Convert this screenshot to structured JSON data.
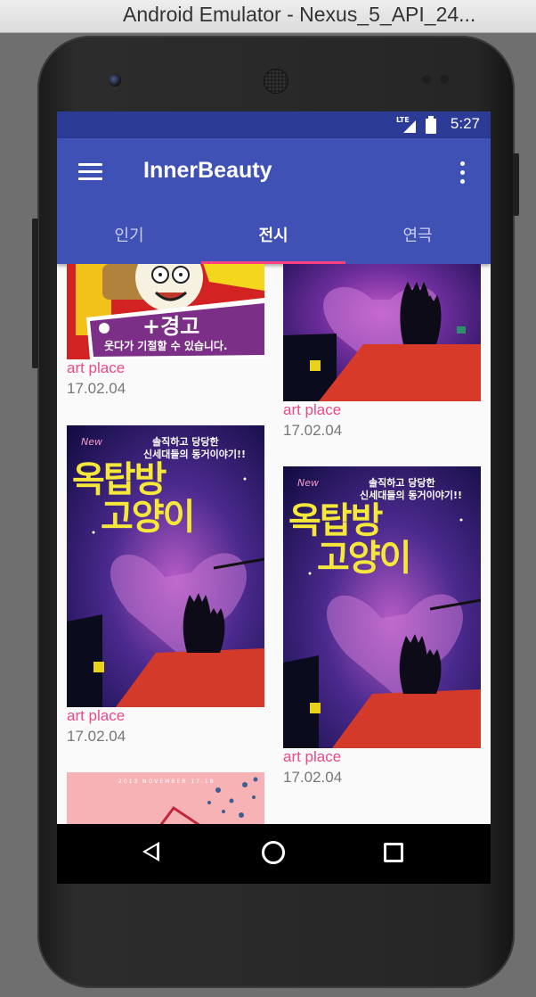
{
  "window": {
    "title": "Android Emulator - Nexus_5_API_24..."
  },
  "status_bar": {
    "time": "5:27",
    "network": "LTE"
  },
  "app_bar": {
    "title": "InnerBeauty"
  },
  "tabs": [
    {
      "label": "인기",
      "active": false
    },
    {
      "label": "전시",
      "active": true
    },
    {
      "label": "연극",
      "active": false
    }
  ],
  "cards": [
    {
      "title": "art place",
      "date": "17.02.04",
      "poster": {
        "text1": "+경고",
        "text2": "웃다가 기절할 수 있습니다."
      }
    },
    {
      "title": "art place",
      "date": "17.02.04"
    },
    {
      "title": "art place",
      "date": "17.02.04",
      "poster": {
        "tagline1": "솔직하고 당당한",
        "tagline2": "신세대들의 동거이야기!!",
        "new": "New",
        "title1": "옥탑방",
        "title2": "고양이"
      }
    },
    {
      "title": "art place",
      "date": "17.02.04",
      "poster": {
        "tagline1": "솔직하고 당당한",
        "tagline2": "신세대들의 동거이야기!!",
        "new": "New",
        "title1": "옥탑방",
        "title2": "고양이"
      }
    },
    {
      "poster": {
        "header": "2013 NOVEMBER 17.18"
      }
    }
  ],
  "colors": {
    "primary": "#3f51b5",
    "primary_dark": "#2c3b96",
    "accent": "#ff4081",
    "card_title": "#e84a8a"
  }
}
